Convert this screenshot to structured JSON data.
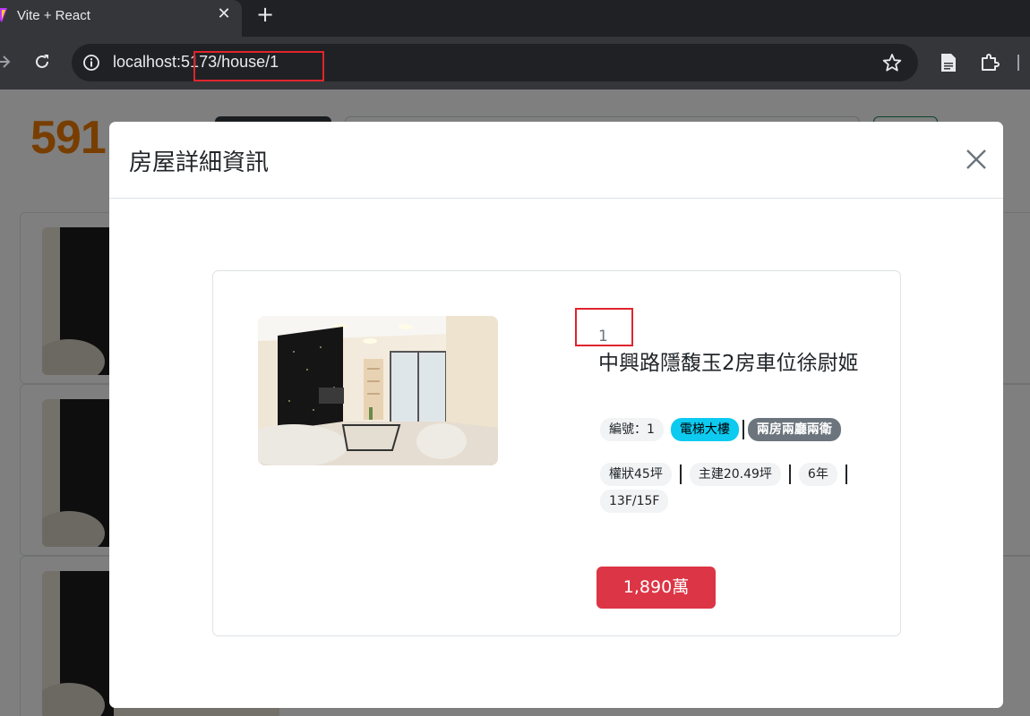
{
  "browser": {
    "tab_title": "Vite + React",
    "tab_close": "✕",
    "new_tab": "+",
    "url": "localhost:5173/house/1"
  },
  "site": {
    "logo_text": "591"
  },
  "modal": {
    "title": "房屋詳細資訊",
    "house": {
      "id_display": "1",
      "title": "中興路隱馥玉2房車位徐尉姬",
      "id_label": "編號：1",
      "building_type": "電梯大樓",
      "layout": "兩房兩廳兩衛",
      "area": "權狀45坪",
      "main_area": "主建20.49坪",
      "age": "6年",
      "floor": "13F/15F",
      "price": "1,890萬"
    }
  },
  "colors": {
    "primary_red": "#dc3545",
    "info_cyan": "#0dcaf0",
    "secondary_gray": "#6c757d",
    "highlight_box": "#e0242c",
    "logo_orange": "#f07c00"
  },
  "icons": [
    "info-icon",
    "star-icon",
    "document-icon",
    "extension-icon",
    "reload-icon",
    "forward-icon",
    "close-icon"
  ]
}
